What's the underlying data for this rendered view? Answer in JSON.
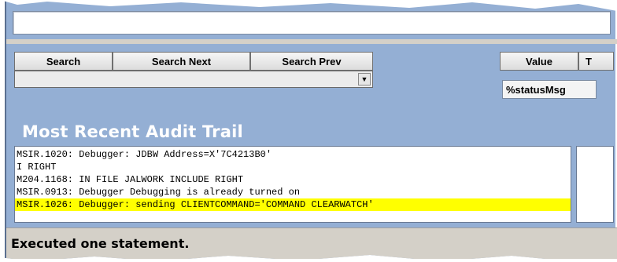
{
  "toolbar": {
    "search_label": "Search",
    "search_next_label": "Search Next",
    "search_prev_label": "Search Prev",
    "value_label": "Value",
    "t_label": "T"
  },
  "search_dropdown": {
    "value": "",
    "arrow_icon": "chevron-down-icon"
  },
  "value_cell": {
    "text": "%statusMsg"
  },
  "audit": {
    "title": "Most Recent Audit Trail",
    "lines": [
      "MSIR.1020: Debugger: JDBW Address=X'7C4213B0'",
      "I RIGHT",
      "M204.1168: IN FILE JALWORK INCLUDE RIGHT",
      "MSIR.0913: Debugger Debugging is already turned on",
      "MSIR.1026: Debugger: sending CLIENTCOMMAND='COMMAND CLEARWATCH'"
    ],
    "highlight_index": 4,
    "highlight_color": "#ffff00"
  },
  "status_bar": {
    "text": "Executed one statement."
  },
  "colors": {
    "window_bg": "#94afd4",
    "status_bg": "#d4d0c8"
  }
}
